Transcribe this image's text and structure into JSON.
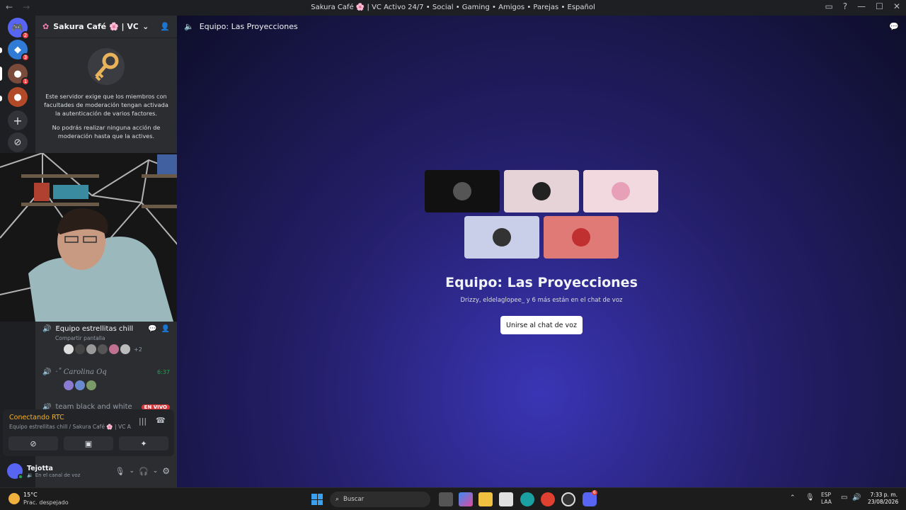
{
  "window": {
    "title": "Sakura Café 🌸 | VC Activo 24/7 • Social • Gaming • Amigos • Parejas • Español"
  },
  "guilds": [
    {
      "name": "discord-home",
      "badge": "2",
      "color": "#5865f2"
    },
    {
      "name": "blue-server",
      "badge": "3",
      "color": "#2f7bd6"
    },
    {
      "name": "sakura-server",
      "badge": "1",
      "color": "#7a4a3a"
    },
    {
      "name": "red-server",
      "badge": "",
      "color": "#b24a2a"
    }
  ],
  "server": {
    "name": "Sakura Café 🌸 | VC Acti..."
  },
  "mfa": {
    "text1": "Este servidor exige que los miembros con facultades de moderación tengan activada la autenticación de varios factores.",
    "text2": "No podrás realizar ninguna acción de moderación hasta que la actives."
  },
  "voice_channels": [
    {
      "name": "Equipo estrellitas chill",
      "sub": "Compartir pantalla",
      "extra": "+2"
    },
    {
      "name": "·˚ Carolina Oq",
      "time": "6:37"
    },
    {
      "name": "team black and white",
      "live": "EN VIVO"
    }
  ],
  "rtc": {
    "status": "Conectando RTC",
    "location": "Equipo estrellitas chill / Sakura Café 🌸 | VC Ac..."
  },
  "user": {
    "name": "Tejotta",
    "status": "En el canal de voz"
  },
  "main": {
    "header": "Equipo: Las Proyecciones",
    "title": "Equipo: Las Proyecciones",
    "subtitle": "Drizzy, eldelaglopee_ y 6 más están en el chat de voz",
    "join_label": "Unirse al chat de voz"
  },
  "tiles": [
    {
      "bg": "#111111",
      "av": "#555"
    },
    {
      "bg": "#e6d3d8",
      "av": "#222"
    },
    {
      "bg": "#f2d9e0",
      "av": "#e8a0b8"
    },
    {
      "bg": "#c9cfe8",
      "av": "#333"
    },
    {
      "bg": "#e07a76",
      "av": "#c03030"
    }
  ],
  "taskbar": {
    "weather_temp": "15°C",
    "weather_desc": "Prac. despejado",
    "search": "Buscar",
    "lang1": "ESP",
    "lang2": "LAA",
    "time": "7:33 p. m.",
    "date": "23/08/2026",
    "discord_badge": "6"
  }
}
